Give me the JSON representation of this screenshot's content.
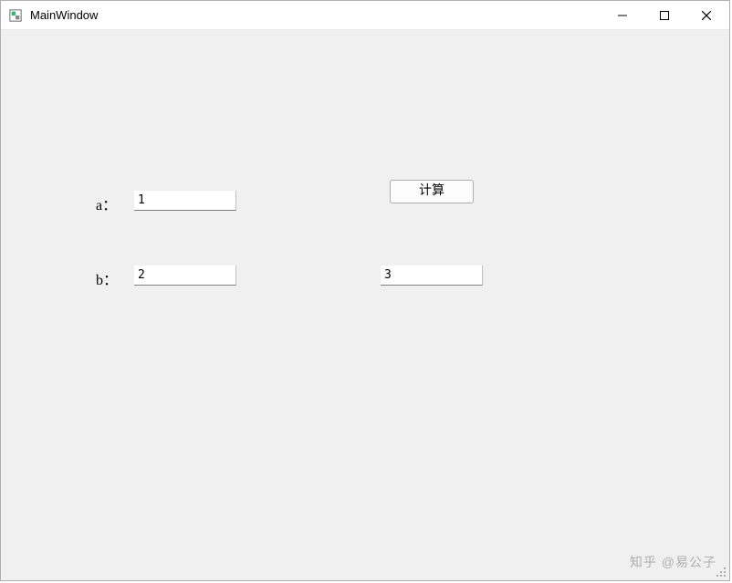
{
  "window": {
    "title": "MainWindow"
  },
  "form": {
    "label_a": "a：",
    "label_b": "b：",
    "input_a_value": "1",
    "input_b_value": "2",
    "result_value": "3",
    "button_calc": "计算"
  },
  "watermark": "知乎 @易公子"
}
